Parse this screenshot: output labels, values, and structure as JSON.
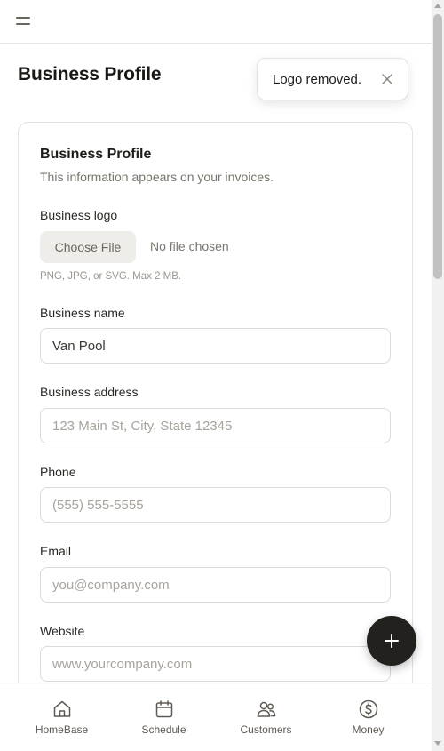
{
  "header": {
    "menu_icon": "hamburger-menu-icon"
  },
  "page": {
    "title": "Business Profile"
  },
  "toast": {
    "message": "Logo removed.",
    "close_icon": "close-icon"
  },
  "card": {
    "title": "Business Profile",
    "subtitle": "This information appears on your invoices."
  },
  "form": {
    "logo": {
      "label": "Business logo",
      "button_label": "Choose File",
      "status": "No file chosen",
      "hint": "PNG, JPG, or SVG. Max 2 MB."
    },
    "business_name": {
      "label": "Business name",
      "value": "Van Pool",
      "placeholder": ""
    },
    "business_address": {
      "label": "Business address",
      "value": "",
      "placeholder": "123 Main St, City, State 12345"
    },
    "phone": {
      "label": "Phone",
      "value": "",
      "placeholder": "(555) 555-5555"
    },
    "email": {
      "label": "Email",
      "value": "",
      "placeholder": "you@company.com"
    },
    "website": {
      "label": "Website",
      "value": "",
      "placeholder": "www.yourcompany.com"
    }
  },
  "fab": {
    "icon": "plus-icon"
  },
  "bottom_nav": {
    "items": [
      {
        "label": "HomeBase",
        "icon": "home-icon"
      },
      {
        "label": "Schedule",
        "icon": "calendar-icon"
      },
      {
        "label": "Customers",
        "icon": "users-icon"
      },
      {
        "label": "Money",
        "icon": "dollar-circle-icon"
      }
    ]
  },
  "colors": {
    "text_primary": "#1f1d1a",
    "text_muted": "#7a766f",
    "border": "#e4e2dd",
    "fab_bg": "#23211d",
    "button_bg": "#efede9"
  }
}
